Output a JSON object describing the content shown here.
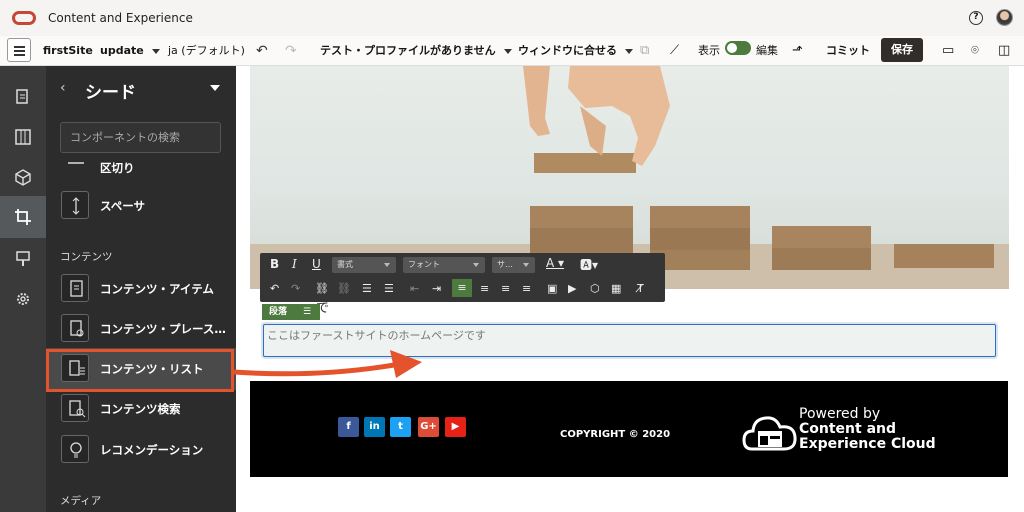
{
  "app": {
    "title": "Content and Experience"
  },
  "toolbar": {
    "site": "firstSite",
    "update": "update",
    "language": "ja (デフォルト)",
    "profile": "テスト・プロファイルがありません",
    "fit": "ウィンドウに合せる",
    "view_label": "表示",
    "edit_label": "編集",
    "commit": "コミット",
    "save": "保存"
  },
  "panel": {
    "title": "シード",
    "search_placeholder": "コンポーネントの検索",
    "items_top": [
      {
        "label": "区切り",
        "icon": "divider-icon"
      },
      {
        "label": "スペーサ",
        "icon": "spacer-icon"
      }
    ],
    "section_content": "コンテンツ",
    "items_content": [
      {
        "label": "コンテンツ・アイテム",
        "icon": "document-icon"
      },
      {
        "label": "コンテンツ・プレース…",
        "icon": "placeholder-icon"
      },
      {
        "label": "コンテンツ・リスト",
        "icon": "list-icon"
      },
      {
        "label": "コンテンツ検索",
        "icon": "search-document-icon"
      },
      {
        "label": "レコメンデーション",
        "icon": "lightbulb-icon"
      }
    ],
    "section_media": "メディア"
  },
  "editor": {
    "format": "書式",
    "font": "フォント",
    "size": "サ…",
    "paragraph_tag": "段落",
    "paragraph_text": "ここはファーストサイトのホームページです",
    "heading_fragment": "で"
  },
  "footer": {
    "social": [
      "f",
      "in",
      "t",
      "G+",
      "▶"
    ],
    "copyright": "COPYRIGHT © 2020",
    "powered_line1": "Powered by",
    "powered_line2": "Content and",
    "powered_line3": "Experience Cloud"
  },
  "colors": {
    "accent": "#4d7a3e",
    "brand": "#c74634",
    "annotation": "#e4532b"
  }
}
